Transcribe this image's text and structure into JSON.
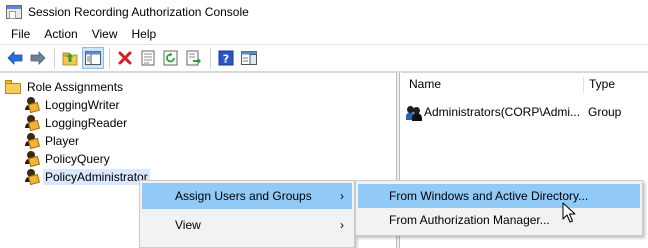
{
  "window": {
    "title": "Session Recording Authorization Console"
  },
  "menubar": {
    "items": [
      "File",
      "Action",
      "View",
      "Help"
    ]
  },
  "toolbar": {
    "buttons": [
      "back-arrow-icon",
      "forward-arrow-icon",
      "up-folder-icon",
      "show-hide-tree-icon",
      "delete-icon",
      "properties-icon",
      "refresh-icon",
      "export-list-icon",
      "help-icon",
      "console-pane-icon"
    ],
    "colors": {
      "back": "#2a6fd6",
      "delete": "#d42020",
      "help": "#2b55c4"
    }
  },
  "tree": {
    "root": "Role Assignments",
    "items": [
      {
        "label": "LoggingWriter",
        "selected": false
      },
      {
        "label": "LoggingReader",
        "selected": false
      },
      {
        "label": "Player",
        "selected": false
      },
      {
        "label": "PolicyQuery",
        "selected": false
      },
      {
        "label": "PolicyAdministrator",
        "selected": true
      }
    ]
  },
  "list": {
    "columns": [
      "Name",
      "Type"
    ],
    "rows": [
      {
        "name": "Administrators(CORP\\Admi...",
        "type": "Group"
      }
    ]
  },
  "context_menu": {
    "items": [
      {
        "label": "Assign Users and Groups",
        "highlighted": true,
        "submenu_arrow": "›"
      },
      {
        "label": "View",
        "highlighted": false,
        "submenu_arrow": "›"
      }
    ]
  },
  "submenu": {
    "items": [
      {
        "label": "From Windows and Active Directory...",
        "highlighted": true
      },
      {
        "label": "From Authorization Manager...",
        "highlighted": false
      }
    ]
  },
  "colors": {
    "menu_highlight": "#91c9f7",
    "tree_selection": "#d9e9fb"
  }
}
